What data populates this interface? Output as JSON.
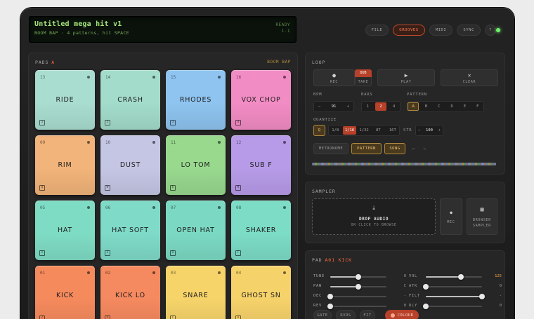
{
  "lcd": {
    "title": "Untitled mega hit v1",
    "subtitle": "BOOM BAP · 4 patterns, hit SPACE",
    "status_line1": "READY",
    "status_line2": "1.1"
  },
  "nav": {
    "file": "FILE",
    "grooves": "GROOVES",
    "midi": "MIDI",
    "sync": "SYNC",
    "help": "?"
  },
  "colors": {
    "accent": "#ff6a3d",
    "lcd_green": "#a7e67a",
    "gold": "#f2c57a",
    "led": "#6ef06a"
  },
  "pads_panel": {
    "title": "PADS",
    "bank": "A",
    "kit": "BOOM BAP",
    "pads": [
      {
        "num": "13",
        "name": "RIDE",
        "key": "1",
        "color": "#a9ddd0"
      },
      {
        "num": "14",
        "name": "CRASH",
        "key": "2",
        "color": "#a3dccb"
      },
      {
        "num": "15",
        "name": "RHODES",
        "key": "3",
        "color": "#8ec4ef"
      },
      {
        "num": "16",
        "name": "VOX CHOP",
        "key": "4",
        "color": "#f28cc4"
      },
      {
        "num": "09",
        "name": "RIM",
        "key": "Q",
        "color": "#f2b47a"
      },
      {
        "num": "10",
        "name": "DUST",
        "key": "W",
        "color": "#c5c6e4"
      },
      {
        "num": "11",
        "name": "LO TOM",
        "key": "E",
        "color": "#98d98e"
      },
      {
        "num": "12",
        "name": "SUB F",
        "key": "R",
        "color": "#b79be8"
      },
      {
        "num": "05",
        "name": "HAT",
        "key": "A",
        "color": "#7fdcc4"
      },
      {
        "num": "06",
        "name": "HAT SOFT",
        "key": "S",
        "color": "#7fdac8"
      },
      {
        "num": "07",
        "name": "OPEN HAT",
        "key": "D",
        "color": "#7bd9c3"
      },
      {
        "num": "08",
        "name": "SHAKER",
        "key": "F",
        "color": "#7cdcc6"
      },
      {
        "num": "01",
        "name": "KICK",
        "key": "Z",
        "color": "#f58a5d"
      },
      {
        "num": "02",
        "name": "KICK LO",
        "key": "X",
        "color": "#f5895f"
      },
      {
        "num": "03",
        "name": "SNARE",
        "key": "C",
        "color": "#f6d46a"
      },
      {
        "num": "04",
        "name": "GHOST SN",
        "key": "V",
        "color": "#f6d26a"
      }
    ]
  },
  "loop": {
    "title": "LOOP",
    "rec": "REC",
    "dub": "DUB",
    "take": "TAKE",
    "play": "PLAY",
    "clear": "CLEAR",
    "bpm_label": "BPM",
    "bpm_minus": "−",
    "bpm_value": "91",
    "bpm_plus": "+",
    "bars_label": "BARS",
    "bars": [
      "1",
      "2",
      "4"
    ],
    "bars_selected": "2",
    "pattern_label": "PATTERN",
    "patterns": [
      "A",
      "B",
      "C",
      "D",
      "E",
      "F"
    ],
    "pattern_selected": "A",
    "quantize_label": "QUANTIZE",
    "q_toggle": "Q",
    "quantize": [
      "1/8",
      "1/16",
      "1/32",
      "8T",
      "16T"
    ],
    "quantize_selected": "1/16",
    "str_label": "STR",
    "str_minus": "−",
    "str_value": "100",
    "str_plus": "+",
    "metronome": "METRONOME",
    "pattern_mode": "PATTERN",
    "song_mode": "SONG"
  },
  "sampler": {
    "title": "SAMPLER",
    "drop_title": "DROP AUDIO",
    "drop_sub": "OR CLICK TO BROWSE",
    "mic": "MIC",
    "browser_line1": "BROWSER",
    "browser_line2": "SAMPLER"
  },
  "pad_editor": {
    "title": "PAD",
    "pad_name": "A01 KICK",
    "controls_left": [
      {
        "label": "TUNE",
        "value": "0",
        "level": 0.5
      },
      {
        "label": "PAN",
        "value": "C",
        "level": 0.5
      },
      {
        "label": "DEC",
        "value": "-",
        "level": 0.0
      },
      {
        "label": "REV",
        "value": "0",
        "level": 0.0
      }
    ],
    "controls_right": [
      {
        "label": "VOL",
        "value": "125",
        "level": 0.62
      },
      {
        "label": "ATK",
        "value": "0",
        "level": 0.0
      },
      {
        "label": "FILT",
        "value": "-",
        "level": 1.0
      },
      {
        "label": "DLY",
        "value": "0",
        "level": 0.0
      }
    ],
    "buttons": [
      "GATE",
      "RVRS",
      "FIT"
    ],
    "colour_button": "COLOUR"
  }
}
